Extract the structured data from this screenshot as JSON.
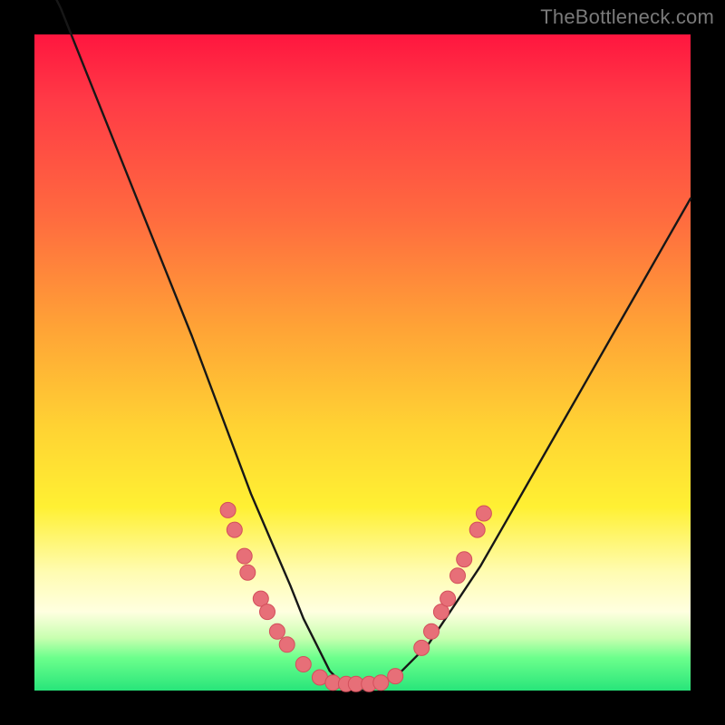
{
  "watermark": "TheBottleneck.com",
  "colors": {
    "background": "#000000",
    "curve_stroke": "#171717",
    "marker_fill": "#e76f78",
    "marker_stroke": "#d34f5b"
  },
  "chart_data": {
    "type": "line",
    "title": "",
    "xlabel": "",
    "ylabel": "",
    "xlim": [
      0,
      100
    ],
    "ylim": [
      0,
      100
    ],
    "grid": false,
    "note": "No numeric axes are shown; x is a normalized 0–100 horizontal position and y is a normalized 0–100 value where 0 is the bottom (green) and 100 is the top (red). Curve estimated from pixel positions.",
    "series": [
      {
        "name": "bottleneck-curve",
        "x": [
          0,
          4,
          8,
          12,
          16,
          20,
          24,
          27,
          30,
          33,
          36,
          39,
          41,
          43,
          45,
          47,
          49,
          51,
          53,
          56,
          60,
          64,
          68,
          72,
          76,
          80,
          84,
          88,
          92,
          96,
          100
        ],
        "y": [
          112,
          104,
          94,
          84,
          74,
          64,
          54,
          46,
          38,
          30,
          23,
          16,
          11,
          7,
          3,
          1,
          0,
          0,
          1,
          3,
          7,
          13,
          19,
          26,
          33,
          40,
          47,
          54,
          61,
          68,
          75
        ]
      }
    ],
    "scatter_markers": {
      "name": "highlight-points",
      "points": [
        {
          "x": 29.5,
          "y": 27.5
        },
        {
          "x": 30.5,
          "y": 24.5
        },
        {
          "x": 32.0,
          "y": 20.5
        },
        {
          "x": 32.5,
          "y": 18.0
        },
        {
          "x": 34.5,
          "y": 14.0
        },
        {
          "x": 35.5,
          "y": 12.0
        },
        {
          "x": 37.0,
          "y": 9.0
        },
        {
          "x": 38.5,
          "y": 7.0
        },
        {
          "x": 41.0,
          "y": 4.0
        },
        {
          "x": 43.5,
          "y": 2.0
        },
        {
          "x": 45.5,
          "y": 1.2
        },
        {
          "x": 47.5,
          "y": 1.0
        },
        {
          "x": 49.0,
          "y": 1.0
        },
        {
          "x": 51.0,
          "y": 1.0
        },
        {
          "x": 52.8,
          "y": 1.2
        },
        {
          "x": 55.0,
          "y": 2.2
        },
        {
          "x": 59.0,
          "y": 6.5
        },
        {
          "x": 60.5,
          "y": 9.0
        },
        {
          "x": 62.0,
          "y": 12.0
        },
        {
          "x": 63.0,
          "y": 14.0
        },
        {
          "x": 64.5,
          "y": 17.5
        },
        {
          "x": 65.5,
          "y": 20.0
        },
        {
          "x": 67.5,
          "y": 24.5
        },
        {
          "x": 68.5,
          "y": 27.0
        }
      ]
    }
  }
}
